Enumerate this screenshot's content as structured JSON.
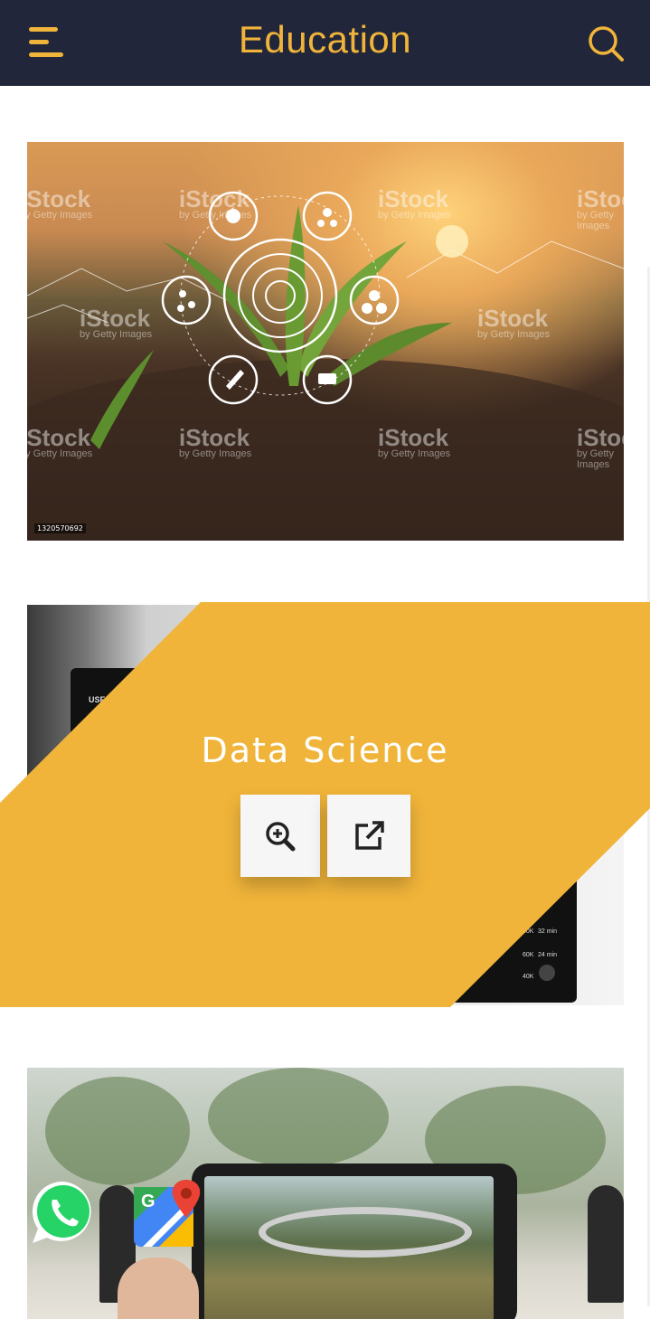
{
  "header": {
    "title": "Education",
    "menu_icon": "hamburger-menu-icon",
    "search_icon": "search-icon",
    "background": "#22263a",
    "accent": "#f0b43a"
  },
  "cards": [
    {
      "image": "agriculture-technology-photo",
      "watermark": "iStock",
      "watermark_sub": "by Getty Images",
      "image_id": "1320570692"
    },
    {
      "image": "tablet-dashboard-photo",
      "overlay_title": "Data Science",
      "overlay_color": "#f0b43a",
      "zoom_icon": "zoom-in-icon",
      "open_icon": "external-link-icon",
      "tablet_texts": [
        "USE",
        "60K",
        "32 min",
        "60K",
        "24 min",
        "40K"
      ]
    },
    {
      "image": "campus-tablet-photo"
    }
  ],
  "floating": {
    "whatsapp_icon": "whatsapp-icon",
    "maps_icon": "google-maps-icon"
  }
}
